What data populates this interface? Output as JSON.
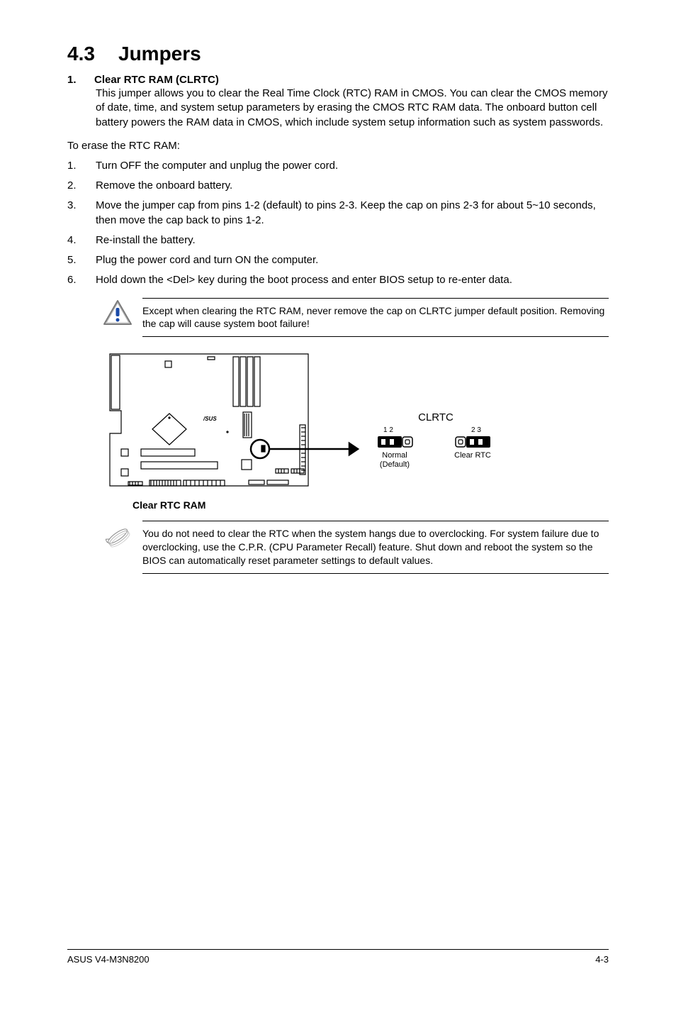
{
  "section": {
    "number": "4.3",
    "title": "Jumpers"
  },
  "item1": {
    "number": "1.",
    "label": "Clear RTC RAM (CLRTC)",
    "body": "This jumper allows you to clear the  Real Time Clock (RTC) RAM in CMOS. You can clear the CMOS memory of date, time, and system setup parameters by erasing the CMOS RTC RAM data. The onboard button cell battery powers the RAM data in CMOS, which include system setup information such as system passwords."
  },
  "intro_line": "To erase the RTC RAM:",
  "steps": [
    {
      "n": "1.",
      "t": "Turn OFF the computer and unplug the power cord."
    },
    {
      "n": "2.",
      "t": "Remove the onboard battery."
    },
    {
      "n": "3.",
      "t": "Move the jumper cap from pins 1-2 (default) to pins 2-3. Keep the cap on pins 2-3 for about 5~10 seconds, then move the cap back to pins  1-2."
    },
    {
      "n": "4.",
      "t": "Re-install the battery."
    },
    {
      "n": "5.",
      "t": "Plug the power cord and turn ON the computer."
    },
    {
      "n": "6.",
      "t": "Hold down the <Del> key during the boot process and enter BIOS setup to re-enter data."
    }
  ],
  "caution_text": "Except when clearing the RTC RAM, never remove the cap on CLRTC jumper default position. Removing the cap will cause system boot failure!",
  "diagram": {
    "clrtc_label": "CLRTC",
    "normal_pins": "1  2",
    "normal_label1": "Normal",
    "normal_label2": "(Default)",
    "clear_pins": "2  3",
    "clear_label": "Clear RTC",
    "caption": "Clear RTC RAM"
  },
  "note_text": "You do not need to clear the RTC when the system hangs due to overclocking. For system failure due to overclocking, use the C.P.R. (CPU Parameter Recall) feature. Shut down and reboot the system so the BIOS can automatically reset parameter settings to default values.",
  "footer": {
    "left": "ASUS V4-M3N8200",
    "right": "4-3"
  }
}
